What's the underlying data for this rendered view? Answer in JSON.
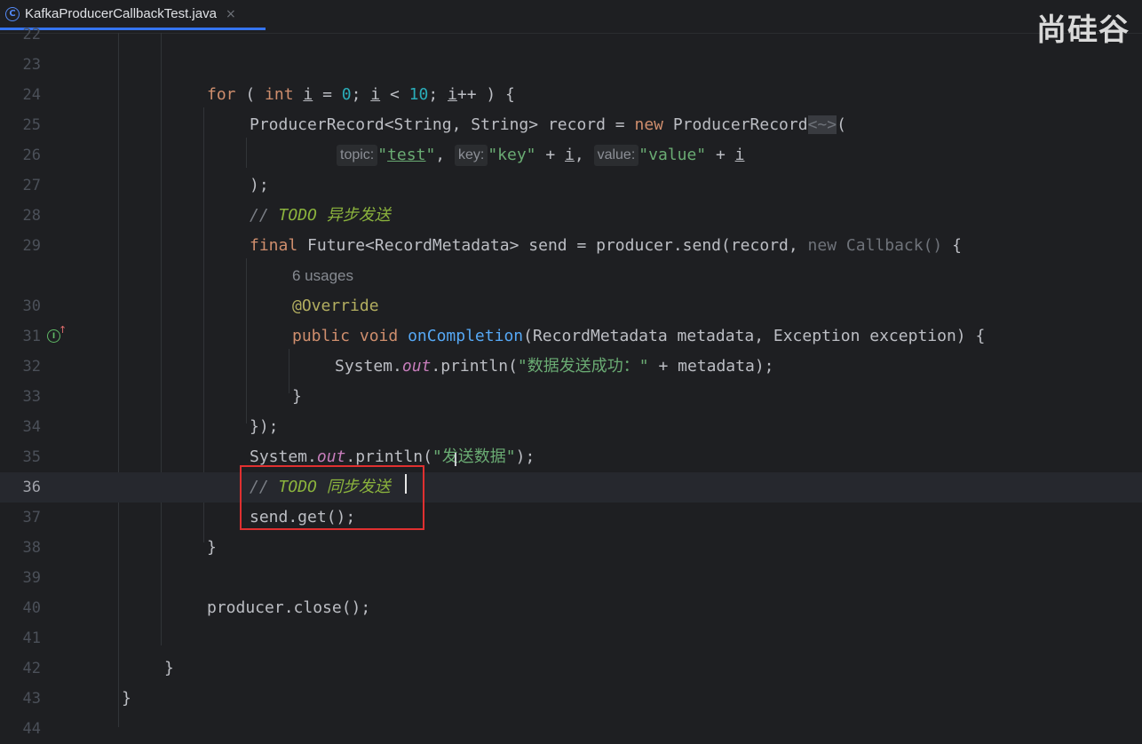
{
  "tab": {
    "icon": "class-c-icon",
    "title": "KafkaProducerCallbackTest.java",
    "close": "×"
  },
  "watermark": "尚硅谷",
  "line_numbers": [
    "22",
    "23",
    "24",
    "25",
    "26",
    "27",
    "28",
    "29",
    "30",
    "31",
    "32",
    "33",
    "34",
    "35",
    "36",
    "37",
    "38",
    "39",
    "40",
    "41",
    "42",
    "43",
    "44"
  ],
  "current_line": "36",
  "code": {
    "l24": {
      "kw_for": "for",
      "p1": " ( ",
      "kw_int": "int",
      "sp1": " ",
      "var_i1": "i",
      "p2": " = ",
      "n0": "0",
      "p3": "; ",
      "var_i2": "i",
      "p4": " < ",
      "n10": "10",
      "p5": "; ",
      "var_i3": "i",
      "p6": "++ ) {"
    },
    "l25": {
      "t1": "ProducerRecord<String, String> record = ",
      "kw_new": "new",
      "t2": " ProducerRecord",
      "diamond": "<~>",
      "t3": "("
    },
    "l26": {
      "hint_topic": "topic:",
      "str_test_q1": "\"",
      "str_test": "test",
      "str_test_q2": "\"",
      "c1": ", ",
      "hint_key": "key:",
      "str_key": "\"key\"",
      "plus1": " + ",
      "var_i": "i",
      "c2": ", ",
      "hint_value": "value:",
      "str_value": "\"value\"",
      "plus2": " + ",
      "var_i_b": "i"
    },
    "l27": ");",
    "l28": {
      "slashes": "// ",
      "todo": "TODO",
      "text": " 异步发送"
    },
    "l29": {
      "kw_final": "final",
      "t1": " Future<RecordMetadata> send = producer.send(record, ",
      "dim": "new Callback()",
      "t2": " {"
    },
    "usages": "6 usages",
    "l30": "@Override",
    "l31": {
      "kw_public": "public",
      "sp1": " ",
      "kw_void": "void",
      "sp2": " ",
      "fn": "onCompletion",
      "t1": "(RecordMetadata metadata, Exception exception) {"
    },
    "l32": {
      "t1": "System.",
      "static": "out",
      "t2": ".println(",
      "str": "\"数据发送成功：\"",
      "t3": " + metadata);"
    },
    "l33": "}",
    "l34": "});",
    "l35": {
      "t1": "System.",
      "static": "out",
      "t2": ".println(",
      "str": "\"发送数据\"",
      "t3": ");"
    },
    "l36": {
      "slashes": "// ",
      "todo": "TODO",
      "text": " 同步发送"
    },
    "l37": "send.get();",
    "l38": "}",
    "l40": "producer.close();",
    "l42": "}",
    "l43": "}"
  },
  "gutter": {
    "implements_icon": "implements-method-icon",
    "arrow": "↑",
    "glyph": "I"
  },
  "colors": {
    "background": "#1e1f22",
    "keyword": "#cf8e6d",
    "string": "#6aab73",
    "number": "#2aacb8",
    "function": "#56a8f5",
    "todo": "#8bb33d",
    "highlight_box": "#e03030",
    "tab_underline": "#3574f0"
  }
}
